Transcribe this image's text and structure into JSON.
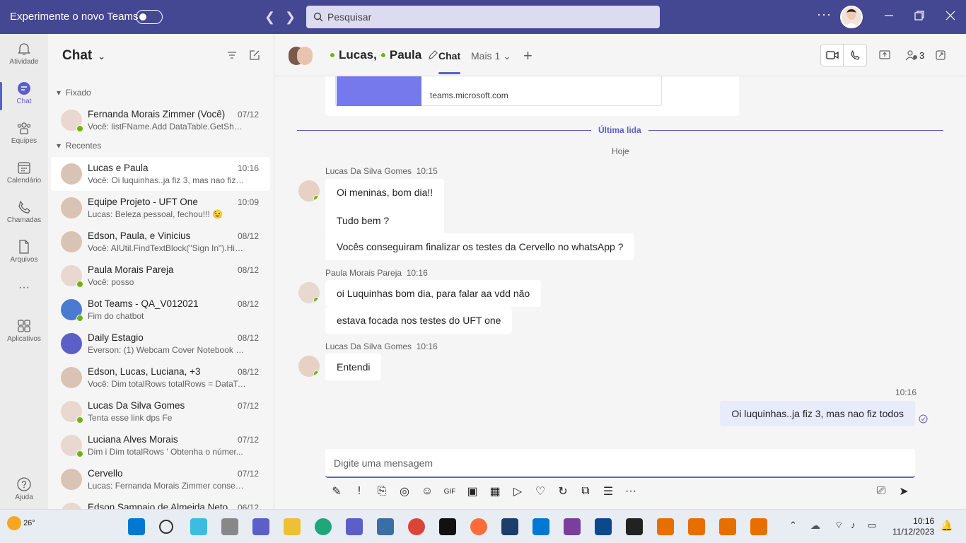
{
  "topbar": {
    "title": "Experimente o novo Teams",
    "search_placeholder": "Pesquisar",
    "more": "···"
  },
  "rail": [
    {
      "label": "Atividade",
      "icon": "bell-icon"
    },
    {
      "label": "Chat",
      "icon": "chat-icon",
      "active": true
    },
    {
      "label": "Equipes",
      "icon": "teams-icon"
    },
    {
      "label": "Calendário",
      "icon": "calendar-icon"
    },
    {
      "label": "Chamadas",
      "icon": "phone-icon"
    },
    {
      "label": "Arquivos",
      "icon": "file-icon"
    },
    {
      "label": "···",
      "icon": "more-icon"
    },
    {
      "label": "Aplicativos",
      "icon": "apps-icon"
    },
    {
      "label": "Ajuda",
      "icon": "help-icon"
    }
  ],
  "chatlist": {
    "title": "Chat",
    "pinned_label": "Fixado",
    "recent_label": "Recentes",
    "pinned": [
      {
        "name": "Fernanda Morais Zimmer (Você)",
        "time": "07/12",
        "preview": "Você: listFName.Add DataTable.GetSheet..."
      }
    ],
    "recent": [
      {
        "name": "Lucas e Paula",
        "time": "10:16",
        "preview": "Você: Oi luquinhas..ja fiz 3, mas nao fiz t...",
        "selected": true
      },
      {
        "name": "Equipe Projeto - UFT One",
        "time": "10:09",
        "preview": "Lucas: Beleza pessoal, fechou!!! 😉"
      },
      {
        "name": "Edson, Paula, e Vinicius",
        "time": "08/12",
        "preview": "Você: AIUtil.FindTextBlock(\"Sign In\").Hig..."
      },
      {
        "name": "Paula Morais Pareja",
        "time": "08/12",
        "preview": "Você: posso"
      },
      {
        "name": "Bot Teams - QA_V012021",
        "time": "08/12",
        "preview": "Fim do chatbot"
      },
      {
        "name": "Daily Estagio",
        "time": "08/12",
        "preview": "Everson: (1) Webcam Cover Notebook Pr..."
      },
      {
        "name": "Edson, Lucas, Luciana, +3",
        "time": "08/12",
        "preview": "Você: Dim totalRows totalRows = DataTa..."
      },
      {
        "name": "Lucas Da Silva Gomes",
        "time": "07/12",
        "preview": "Tenta esse link dps Fe"
      },
      {
        "name": "Luciana Alves Morais",
        "time": "07/12",
        "preview": "Dim i Dim totalRows ' Obtenha o númer..."
      },
      {
        "name": "Cervello",
        "time": "07/12",
        "preview": "Lucas: Fernanda Morais Zimmer consegu..."
      },
      {
        "name": "Edson Sampaio de Almeida Neto",
        "time": "06/12",
        "preview": ""
      }
    ]
  },
  "conversation": {
    "title_name1": "Lucas,",
    "title_name2": "Paula",
    "tab_chat": "Chat",
    "tab_more": "Mais 1",
    "participants": "3",
    "link_url": "teams.microsoft.com",
    "last_read": "Última lida",
    "today": "Hoje",
    "messages": [
      {
        "sender": "Lucas Da Silva Gomes",
        "time": "10:15",
        "bubbles": [
          "Oi meninas, bom dia!!",
          "Tudo bem ?",
          "Vocês conseguiram finalizar os testes da Cervello no whatsApp ?"
        ]
      },
      {
        "sender": "Paula Morais Pareja",
        "time": "10:16",
        "bubbles": [
          "oi Luquinhas bom dia, para falar aa vdd não",
          "estava focada nos testes do UFT one"
        ]
      },
      {
        "sender": "Lucas Da Silva Gomes",
        "time": "10:16",
        "bubbles": [
          "Entendi"
        ]
      }
    ],
    "mine": {
      "time": "10:16",
      "text": "Oi luquinhas..ja fiz 3, mas nao fiz todos"
    },
    "compose_placeholder": "Digite uma mensagem"
  },
  "taskbar": {
    "temp": "26°",
    "time": "10:16",
    "date": "11/12/2023"
  },
  "colors": {
    "brand": "#444791",
    "accent": "#5b5fc7",
    "online": "#6bb700"
  }
}
